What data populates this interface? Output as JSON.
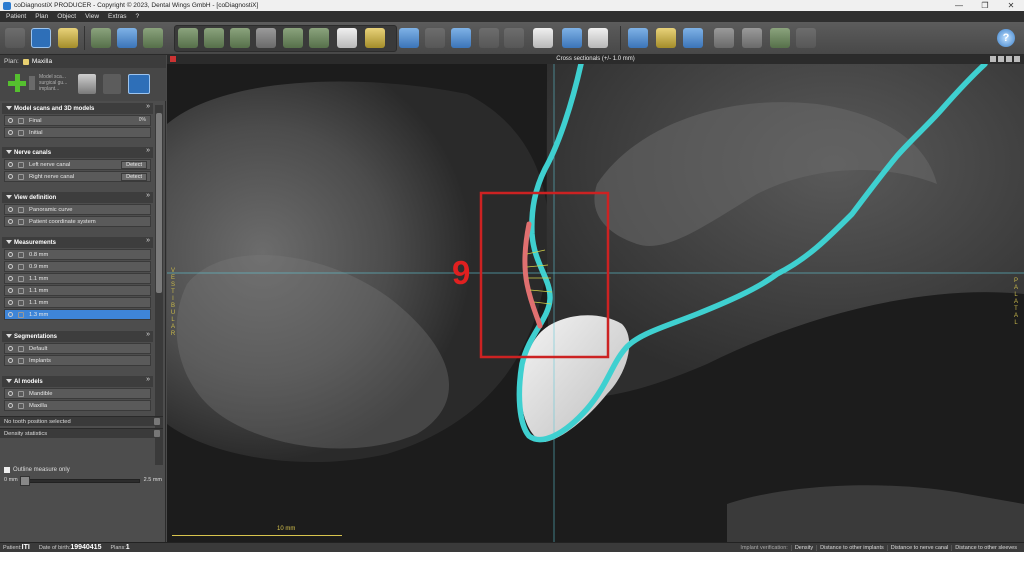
{
  "window": {
    "title": "coDiagnostiX PRODUCER - Copyright © 2023, Dental Wings GmbH - [coDiagnostiX]",
    "minimize": "—",
    "maximize": "❐",
    "close": "✕"
  },
  "menu": [
    "Patient",
    "Plan",
    "Object",
    "View",
    "Extras",
    "?"
  ],
  "plan": {
    "label": "Plan:",
    "name": "Maxilla"
  },
  "add_hint": "Model sca... surgical gu... implant...",
  "sections": {
    "models": {
      "title": "Model scans and 3D models",
      "items": [
        {
          "label": "Final",
          "pct": "0%"
        },
        {
          "label": "Initial"
        }
      ]
    },
    "nerve": {
      "title": "Nerve canals",
      "detect_label": "Detect",
      "items": [
        {
          "label": "Left nerve canal"
        },
        {
          "label": "Right nerve canal"
        }
      ]
    },
    "view": {
      "title": "View definition",
      "items": [
        {
          "label": "Panoramic curve"
        },
        {
          "label": "Patient coordinate system"
        }
      ]
    },
    "measurements": {
      "title": "Measurements",
      "items": [
        {
          "label": "0.8 mm"
        },
        {
          "label": "0.9 mm"
        },
        {
          "label": "1.1 mm"
        },
        {
          "label": "1.1 mm"
        },
        {
          "label": "1.1 mm"
        },
        {
          "label": "1.3 mm"
        }
      ]
    },
    "segmentations": {
      "title": "Segmentations",
      "items": [
        {
          "label": "Default"
        },
        {
          "label": "Implants"
        }
      ]
    },
    "ai": {
      "title": "AI models",
      "items": [
        {
          "label": "Mandible"
        },
        {
          "label": "Maxilla"
        }
      ]
    }
  },
  "dropdowns": {
    "tooth_position": "No tooth position selected",
    "density": "Density statistics"
  },
  "outline": "Outline measure only",
  "slider": {
    "min": "0 mm",
    "max": "2.5 mm"
  },
  "viewport": {
    "title": "Cross sectionals (+/- 1.0 mm)",
    "left_label": [
      "V",
      "E",
      "S",
      "T",
      "I",
      "B",
      "U",
      "L",
      "A",
      "R"
    ],
    "right_label": [
      "P",
      "A",
      "L",
      "A",
      "T",
      "A",
      "L"
    ],
    "scale_label": "10 mm",
    "tooth_number": "9"
  },
  "status": {
    "patient_label": "Patient:",
    "patient_value": "ITI",
    "dob_label": "Date of birth:",
    "dob_value": "19940415",
    "plans_label": "Plans:",
    "plans_value": "1",
    "implant_verification": "Implant verification:",
    "right_items": [
      "Density",
      "Distance to other implants",
      "Distance to nerve canal",
      "Distance to other sleeves"
    ]
  },
  "colors": {
    "outline": "#3fd0d0",
    "bone": "#e07070",
    "roi": "#cc2222",
    "accent": "#3e85d8"
  }
}
